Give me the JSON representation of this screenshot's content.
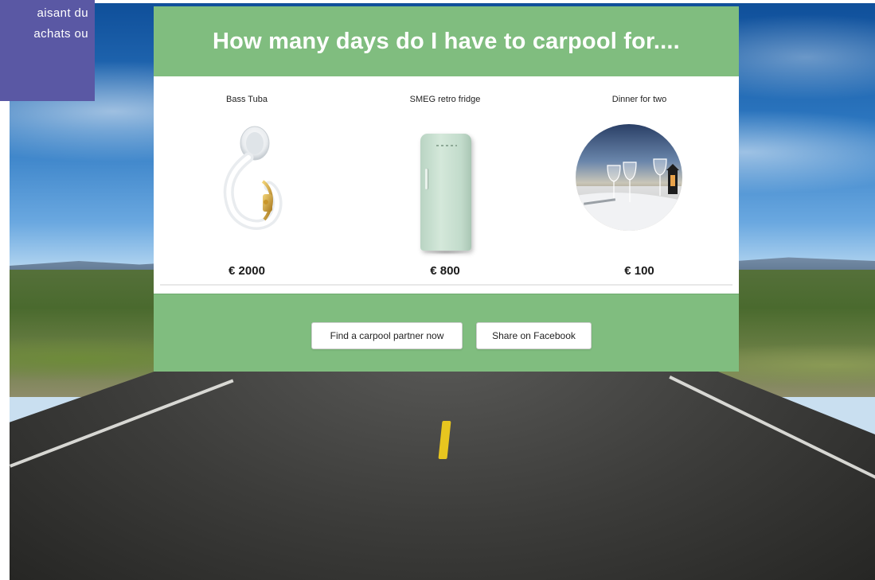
{
  "note": {
    "line1": "aisant du",
    "line2": "achats ou"
  },
  "card": {
    "title": "How many days do I have to carpool for....",
    "items": [
      {
        "name": "Bass Tuba",
        "price": "€ 2000",
        "icon": "tuba-image"
      },
      {
        "name": "SMEG retro fridge",
        "price": "€ 800",
        "icon": "fridge-image"
      },
      {
        "name": "Dinner for two",
        "price": "€ 100",
        "icon": "dinner-table-image"
      }
    ],
    "buttons": {
      "carpool": "Find a carpool partner now",
      "facebook": "Share on Facebook"
    }
  },
  "colors": {
    "header_green": "#80bd7f",
    "note_box": "#5a58a4"
  }
}
